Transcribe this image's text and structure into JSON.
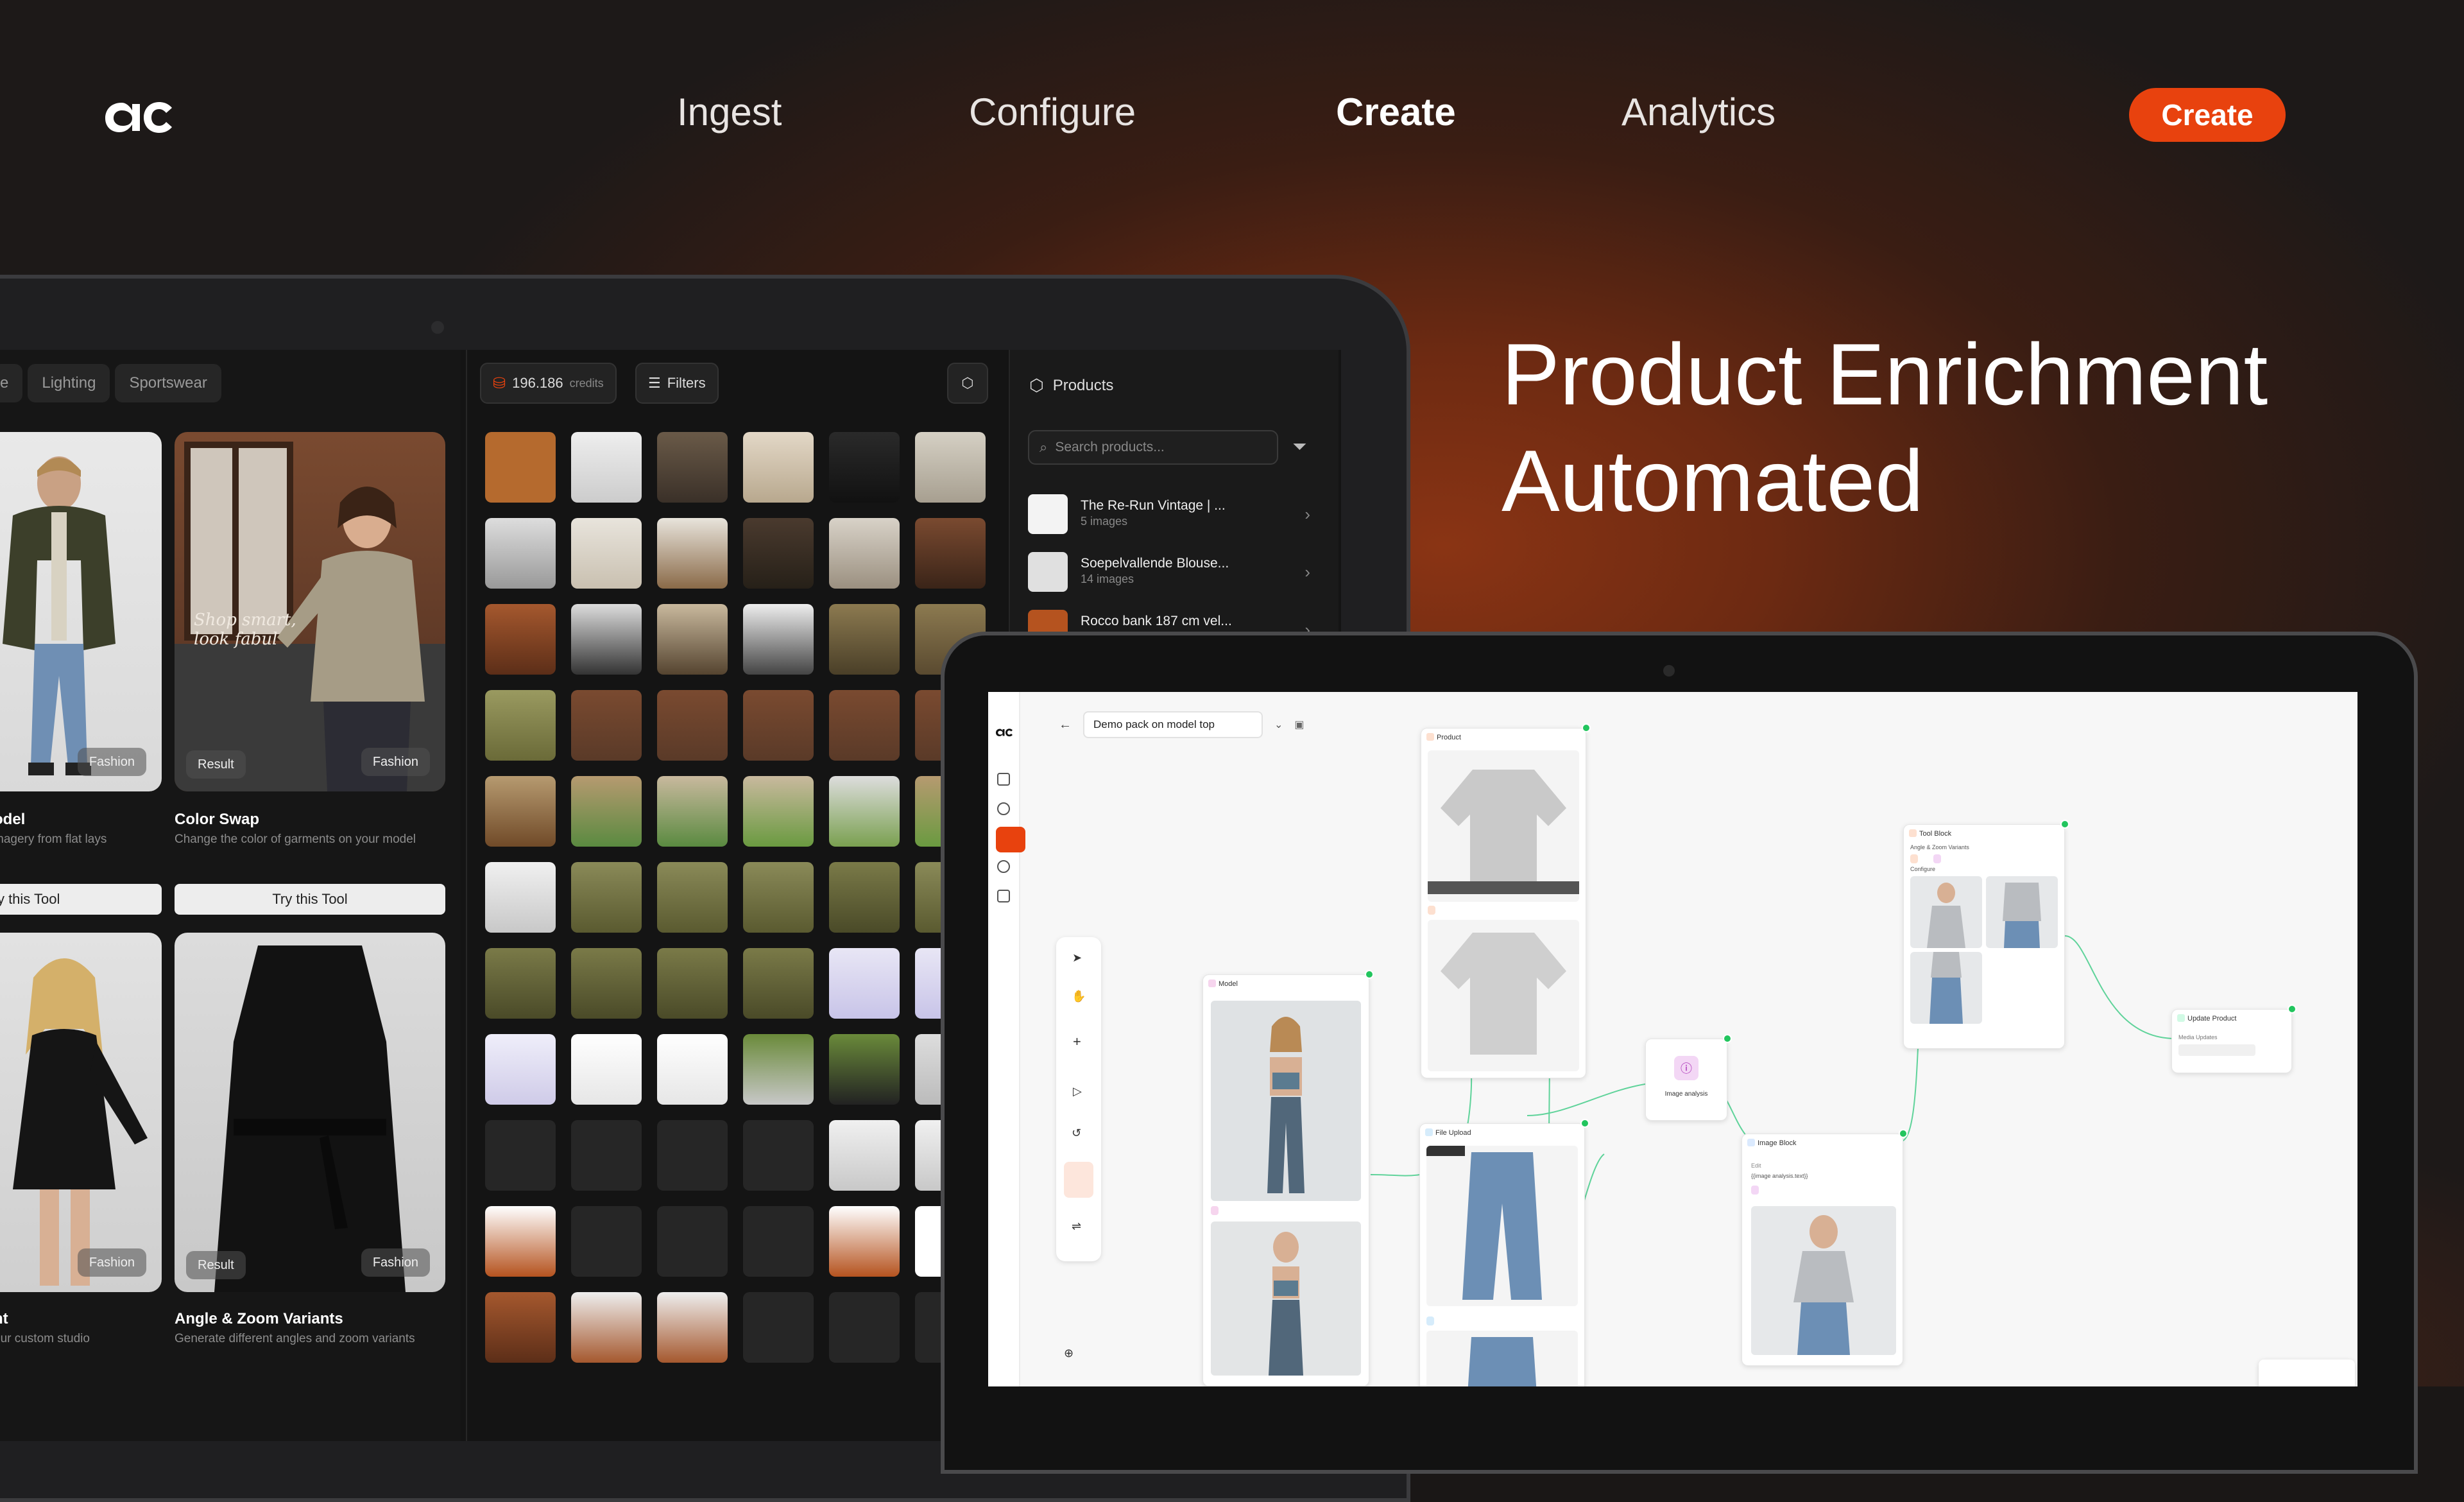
{
  "nav": {
    "items": [
      "Ingest",
      "Configure",
      "Create",
      "Analytics"
    ],
    "active": "Create",
    "cta_label": "Create"
  },
  "headline": {
    "line1": "Product Enrichment",
    "line2": "Automated"
  },
  "back_app": {
    "tags": [
      "e",
      "Lighting",
      "Sportswear"
    ],
    "credits_value": "196.186",
    "credits_label": "credits",
    "filters_label": "Filters",
    "tools": [
      {
        "title": "odel",
        "desc": "magery from flat lays",
        "button": "ry this Tool",
        "badge": "Fashion"
      },
      {
        "title": "Color Swap",
        "desc": "Change the color of garments on your model",
        "button": "Try this Tool",
        "badge": "Fashion",
        "result": "Result",
        "overlay": "Shop smart, look fabul"
      },
      {
        "title": "nt",
        "desc": "our custom studio",
        "badge": "Fashion"
      },
      {
        "title": "Angle & Zoom Variants",
        "desc": "Generate different angles and zoom variants",
        "badge": "Fashion",
        "result": "Result"
      }
    ],
    "products_title": "Products",
    "search_placeholder": "Search products...",
    "products": [
      {
        "name": "The Re-Run Vintage | ...",
        "count": "5 images"
      },
      {
        "name": "Soepelvallende Blouse...",
        "count": "14 images"
      },
      {
        "name": "Rocco bank 187 cm vel...",
        "count": ""
      }
    ]
  },
  "front_app": {
    "pack_name": "Demo pack on model top",
    "nodes": {
      "product": "Product",
      "model": "Model",
      "file_upload": "File Upload",
      "image_analysis": "Image analysis",
      "image_block": "Image Block",
      "tool_block": "Tool Block",
      "tool_block_sub": "Angle & Zoom Variants",
      "configure": "Configure",
      "update_product": "Update Product",
      "media_updates": "Media Updates",
      "edit_label": "Edit",
      "prompt": "{{image analysis.text}}"
    }
  },
  "colors": {
    "accent": "#e8420e",
    "port": "#22c55e"
  }
}
